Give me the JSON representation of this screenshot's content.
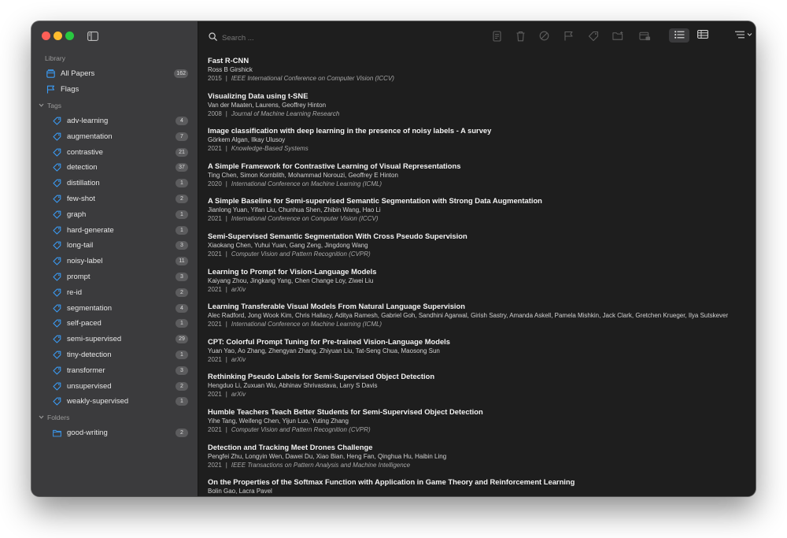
{
  "sidebar": {
    "library_label": "Library",
    "all_papers": {
      "label": "All Papers",
      "count": "162"
    },
    "flags": {
      "label": "Flags"
    },
    "tags_label": "Tags",
    "tags": [
      {
        "label": "adv-learning",
        "count": "4"
      },
      {
        "label": "augmentation",
        "count": "7"
      },
      {
        "label": "contrastive",
        "count": "21"
      },
      {
        "label": "detection",
        "count": "37"
      },
      {
        "label": "distillation",
        "count": "1"
      },
      {
        "label": "few-shot",
        "count": "2"
      },
      {
        "label": "graph",
        "count": "1"
      },
      {
        "label": "hard-generate",
        "count": "1"
      },
      {
        "label": "long-tail",
        "count": "3"
      },
      {
        "label": "noisy-label",
        "count": "11"
      },
      {
        "label": "prompt",
        "count": "3"
      },
      {
        "label": "re-id",
        "count": "2"
      },
      {
        "label": "segmentation",
        "count": "4"
      },
      {
        "label": "self-paced",
        "count": "1"
      },
      {
        "label": "semi-supervised",
        "count": "29"
      },
      {
        "label": "tiny-detection",
        "count": "1"
      },
      {
        "label": "transformer",
        "count": "3"
      },
      {
        "label": "unsupervised",
        "count": "2"
      },
      {
        "label": "weakly-supervised",
        "count": "1"
      }
    ],
    "folders_label": "Folders",
    "folders": [
      {
        "label": "good-writing",
        "count": "2"
      }
    ]
  },
  "search": {
    "placeholder": "Search ..."
  },
  "colors": {
    "accent": "#3b9cf6",
    "sidebar_bg": "#3b3b3d",
    "main_bg": "#1e1e1e"
  },
  "papers": [
    {
      "title": "Fast R-CNN",
      "authors": "Ross B Girshick",
      "year": "2015",
      "venue": "IEEE International Conference on Computer Vision (ICCV)"
    },
    {
      "title": "Visualizing Data using t-SNE",
      "authors": "Van der Maaten, Laurens, Geoffrey Hinton",
      "year": "2008",
      "venue": "Journal of Machine Learning Research"
    },
    {
      "title": "Image classification with deep learning in the presence of noisy labels - A survey",
      "authors": "Görkem Algan, Ilkay Ulusoy",
      "year": "2021",
      "venue": "Knowledge-Based Systems"
    },
    {
      "title": "A Simple Framework for Contrastive Learning of Visual Representations",
      "authors": "Ting Chen, Simon Kornblith, Mohammad Norouzi, Geoffrey E Hinton",
      "year": "2020",
      "venue": "International Conference on Machine Learning (ICML)"
    },
    {
      "title": "A Simple Baseline for Semi-supervised Semantic Segmentation with Strong  Data Augmentation",
      "authors": "Jianlong Yuan, Yifan Liu, Chunhua Shen, Zhibin Wang, Hao Li",
      "year": "2021",
      "venue": "International Conference on Computer Vision (ICCV)"
    },
    {
      "title": "Semi-Supervised Semantic Segmentation With Cross Pseudo Supervision",
      "authors": "Xiaokang Chen, Yuhui Yuan, Gang Zeng, Jingdong Wang",
      "year": "2021",
      "venue": "Computer Vision and Pattern Recognition (CVPR)"
    },
    {
      "title": "Learning to Prompt for Vision-Language Models",
      "authors": "Kaiyang Zhou, Jingkang Yang, Chen Change Loy, Ziwei Liu",
      "year": "2021",
      "venue": "arXiv"
    },
    {
      "title": "Learning Transferable Visual Models From Natural Language Supervision",
      "authors": "Alec Radford, Jong Wook Kim, Chris Hallacy, Aditya Ramesh, Gabriel Goh, Sandhini Agarwal, Girish Sastry, Amanda Askell, Pamela Mishkin, Jack Clark, Gretchen Krueger, Ilya Sutskever",
      "year": "2021",
      "venue": "International Conference on Machine Learning (ICML)"
    },
    {
      "title": "CPT: Colorful Prompt Tuning for Pre-trained Vision-Language Models",
      "authors": "Yuan Yao, Ao Zhang, Zhengyan Zhang, Zhiyuan Liu, Tat-Seng Chua, Maosong Sun",
      "year": "2021",
      "venue": "arXiv"
    },
    {
      "title": "Rethinking Pseudo Labels for Semi-Supervised Object Detection",
      "authors": "Hengduo Li, Zuxuan Wu, Abhinav Shrivastava, Larry S Davis",
      "year": "2021",
      "venue": "arXiv"
    },
    {
      "title": "Humble Teachers Teach Better Students for Semi-Supervised Object Detection",
      "authors": "Yihe Tang, Weifeng Chen, Yijun Luo, Yuting Zhang",
      "year": "2021",
      "venue": "Computer Vision and Pattern Recognition (CVPR)"
    },
    {
      "title": "Detection and Tracking Meet Drones Challenge",
      "authors": "Pengfei Zhu, Longyin Wen, Dawei Du, Xiao Bian, Heng Fan, Qinghua Hu, Haibin Ling",
      "year": "2021",
      "venue": "IEEE Transactions on Pattern Analysis and Machine Intelligence"
    },
    {
      "title": "On the Properties of the Softmax Function with Application in Game  Theory and Reinforcement Learning",
      "authors": "Bolin Gao, Lacra Pavel",
      "year": "",
      "venue": ""
    }
  ]
}
